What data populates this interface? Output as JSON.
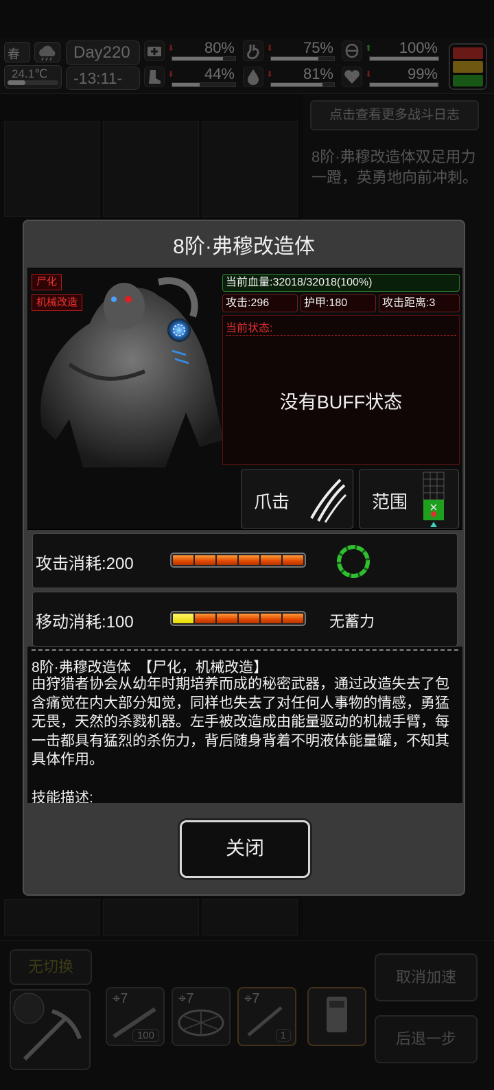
{
  "top_bar": {
    "season": "春",
    "temperature": "24.1℃",
    "day": "Day220",
    "time": "-13:11-",
    "stats": [
      {
        "name": "health-kit",
        "value": "80%",
        "fill": 0.8,
        "trend": "down"
      },
      {
        "name": "stomach",
        "value": "75%",
        "fill": 0.75,
        "trend": "down"
      },
      {
        "name": "pill",
        "value": "100%",
        "fill": 1.0,
        "trend": "up"
      },
      {
        "name": "boot",
        "value": "44%",
        "fill": 0.44,
        "trend": "down"
      },
      {
        "name": "water-drop",
        "value": "81%",
        "fill": 0.81,
        "trend": "down"
      },
      {
        "name": "heart",
        "value": "99%",
        "fill": 0.99,
        "trend": "down"
      }
    ],
    "traffic_light_colors": [
      "#c0302a",
      "#c8a020",
      "#2aa02a"
    ]
  },
  "background": {
    "log_button": "点击查看更多战斗日志",
    "log_text": "8阶·弗穆改造体双足用力一蹬，英勇地向前冲刺。",
    "no_switch": "无切换",
    "cancel_speed": "取消加速",
    "step_back": "后退一步",
    "slots": [
      {
        "level": "7",
        "count": "100"
      },
      {
        "level": "7",
        "count": ""
      },
      {
        "level": "7",
        "count": "1"
      },
      {
        "level": "",
        "count": ""
      }
    ]
  },
  "modal": {
    "title": "8阶·弗穆改造体",
    "tags": [
      "尸化",
      "机械改造"
    ],
    "hp": "当前血量:32018/32018(100%)",
    "attack": "攻击:296",
    "armor": "护甲:180",
    "range": "攻击距离:3",
    "status_label": "当前状态:",
    "buff_text": "没有BUFF状态",
    "skill_claw": "爪击",
    "skill_range": "范围",
    "attack_cost": "攻击消耗:200",
    "attack_cost_fill": 1.0,
    "move_cost": "移动消耗:100",
    "move_cost_fill": 0.17,
    "no_charge": "无蓄力",
    "desc_title": "8阶·弗穆改造体　【尸化，机械改造】",
    "desc_body": "由狩猎者协会从幼年时期培养而成的秘密武器，通过改造失去了包含痛觉在内大部分知觉，同样也失去了对任何人事物的情感，勇猛无畏，天然的杀戮机器。左手被改造成由能量驱动的机械手臂，每一击都具有猛烈的杀伤力，背后随身背着不明液体能量罐，不知其具体作用。",
    "skill_desc_label": "技能描述:",
    "close": "关闭"
  }
}
